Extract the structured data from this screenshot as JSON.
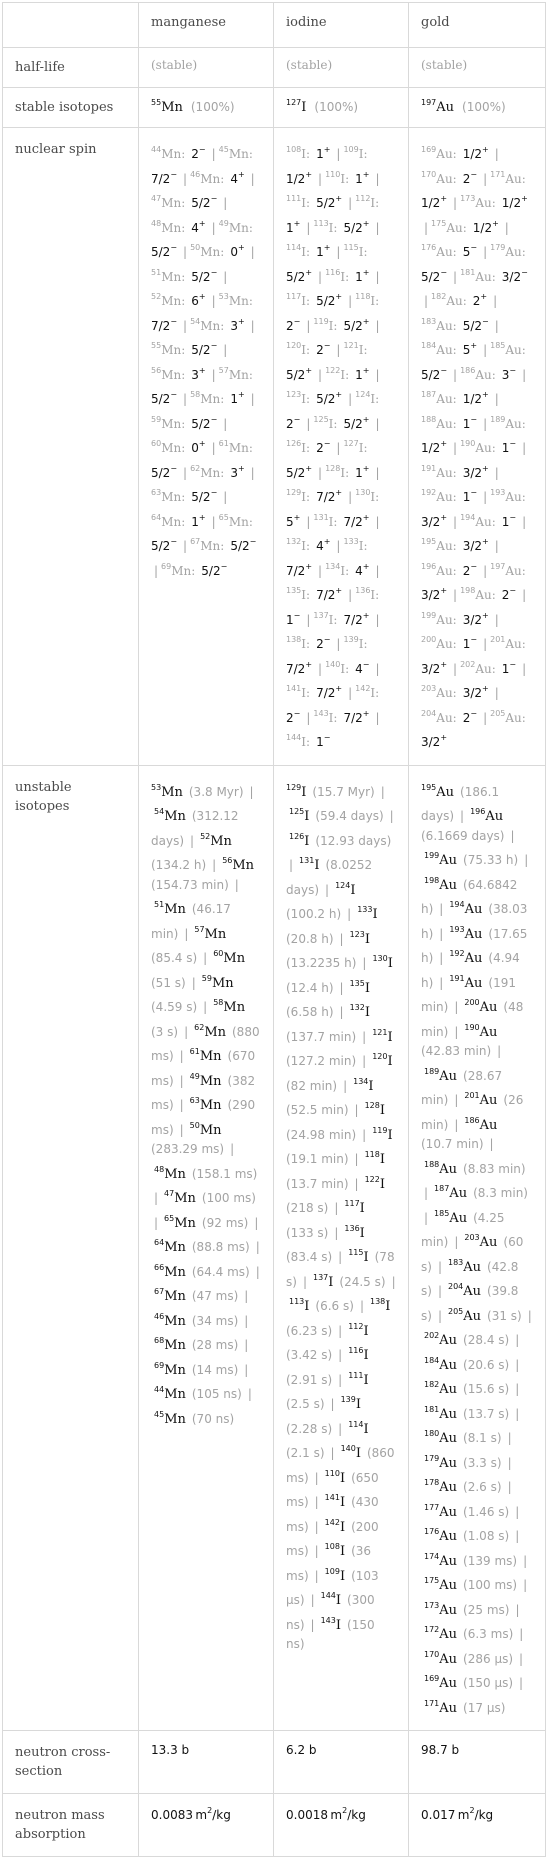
{
  "columns": [
    "manganese",
    "iodine",
    "gold"
  ],
  "rows": {
    "half_life": {
      "label": "half-life",
      "values": [
        "(stable)",
        "(stable)",
        "(stable)"
      ]
    },
    "stable_isotopes": {
      "label": "stable isotopes",
      "values": [
        {
          "mass": "55",
          "symbol": "Mn",
          "abundance": "(100%)"
        },
        {
          "mass": "127",
          "symbol": "I",
          "abundance": "(100%)"
        },
        {
          "mass": "197",
          "symbol": "Au",
          "abundance": "(100%)"
        }
      ]
    },
    "nuclear_spin": {
      "label": "nuclear spin",
      "values": [
        {
          "symbol": "Mn",
          "items": [
            [
              "44",
              "2",
              "−"
            ],
            [
              "45",
              "7/2",
              "−"
            ],
            [
              "46",
              "4",
              "+"
            ],
            [
              "47",
              "5/2",
              "−"
            ],
            [
              "48",
              "4",
              "+"
            ],
            [
              "49",
              "5/2",
              "−"
            ],
            [
              "50",
              "0",
              "+"
            ],
            [
              "51",
              "5/2",
              "−"
            ],
            [
              "52",
              "6",
              "+"
            ],
            [
              "53",
              "7/2",
              "−"
            ],
            [
              "54",
              "3",
              "+"
            ],
            [
              "55",
              "5/2",
              "−"
            ],
            [
              "56",
              "3",
              "+"
            ],
            [
              "57",
              "5/2",
              "−"
            ],
            [
              "58",
              "1",
              "+"
            ],
            [
              "59",
              "5/2",
              "−"
            ],
            [
              "60",
              "0",
              "+"
            ],
            [
              "61",
              "5/2",
              "−"
            ],
            [
              "62",
              "3",
              "+"
            ],
            [
              "63",
              "5/2",
              "−"
            ],
            [
              "64",
              "1",
              "+"
            ],
            [
              "65",
              "5/2",
              "−"
            ],
            [
              "67",
              "5/2",
              "−"
            ],
            [
              "69",
              "5/2",
              "−"
            ]
          ]
        },
        {
          "symbol": "I",
          "items": [
            [
              "108",
              "1",
              "+"
            ],
            [
              "109",
              "1/2",
              "+"
            ],
            [
              "110",
              "1",
              "+"
            ],
            [
              "111",
              "5/2",
              "+"
            ],
            [
              "112",
              "1",
              "+"
            ],
            [
              "113",
              "5/2",
              "+"
            ],
            [
              "114",
              "1",
              "+"
            ],
            [
              "115",
              "5/2",
              "+"
            ],
            [
              "116",
              "1",
              "+"
            ],
            [
              "117",
              "5/2",
              "+"
            ],
            [
              "118",
              "2",
              "−"
            ],
            [
              "119",
              "5/2",
              "+"
            ],
            [
              "120",
              "2",
              "−"
            ],
            [
              "121",
              "5/2",
              "+"
            ],
            [
              "122",
              "1",
              "+"
            ],
            [
              "123",
              "5/2",
              "+"
            ],
            [
              "124",
              "2",
              "−"
            ],
            [
              "125",
              "5/2",
              "+"
            ],
            [
              "126",
              "2",
              "−"
            ],
            [
              "127",
              "5/2",
              "+"
            ],
            [
              "128",
              "1",
              "+"
            ],
            [
              "129",
              "7/2",
              "+"
            ],
            [
              "130",
              "5",
              "+"
            ],
            [
              "131",
              "7/2",
              "+"
            ],
            [
              "132",
              "4",
              "+"
            ],
            [
              "133",
              "7/2",
              "+"
            ],
            [
              "134",
              "4",
              "+"
            ],
            [
              "135",
              "7/2",
              "+"
            ],
            [
              "136",
              "1",
              "−"
            ],
            [
              "137",
              "7/2",
              "+"
            ],
            [
              "138",
              "2",
              "−"
            ],
            [
              "139",
              "7/2",
              "+"
            ],
            [
              "140",
              "4",
              "−"
            ],
            [
              "141",
              "7/2",
              "+"
            ],
            [
              "142",
              "2",
              "−"
            ],
            [
              "143",
              "7/2",
              "+"
            ],
            [
              "144",
              "1",
              "−"
            ]
          ]
        },
        {
          "symbol": "Au",
          "items": [
            [
              "169",
              "1/2",
              "+"
            ],
            [
              "170",
              "2",
              "−"
            ],
            [
              "171",
              "1/2",
              "+"
            ],
            [
              "173",
              "1/2",
              "+"
            ],
            [
              "175",
              "1/2",
              "+"
            ],
            [
              "176",
              "5",
              "−"
            ],
            [
              "179",
              "5/2",
              "−"
            ],
            [
              "181",
              "3/2",
              "−"
            ],
            [
              "182",
              "2",
              "+"
            ],
            [
              "183",
              "5/2",
              "−"
            ],
            [
              "184",
              "5",
              "+"
            ],
            [
              "185",
              "5/2",
              "−"
            ],
            [
              "186",
              "3",
              "−"
            ],
            [
              "187",
              "1/2",
              "+"
            ],
            [
              "188",
              "1",
              "−"
            ],
            [
              "189",
              "1/2",
              "+"
            ],
            [
              "190",
              "1",
              "−"
            ],
            [
              "191",
              "3/2",
              "+"
            ],
            [
              "192",
              "1",
              "−"
            ],
            [
              "193",
              "3/2",
              "+"
            ],
            [
              "194",
              "1",
              "−"
            ],
            [
              "195",
              "3/2",
              "+"
            ],
            [
              "196",
              "2",
              "−"
            ],
            [
              "197",
              "3/2",
              "+"
            ],
            [
              "198",
              "2",
              "−"
            ],
            [
              "199",
              "3/2",
              "+"
            ],
            [
              "200",
              "1",
              "−"
            ],
            [
              "201",
              "3/2",
              "+"
            ],
            [
              "202",
              "1",
              "−"
            ],
            [
              "203",
              "3/2",
              "+"
            ],
            [
              "204",
              "2",
              "−"
            ],
            [
              "205",
              "3/2",
              "+"
            ]
          ]
        }
      ]
    },
    "unstable_isotopes": {
      "label": "unstable isotopes",
      "values": [
        {
          "symbol": "Mn",
          "items": [
            [
              "53",
              "3.8 Myr"
            ],
            [
              "54",
              "312.12 days"
            ],
            [
              "52",
              "134.2 h"
            ],
            [
              "56",
              "154.73 min"
            ],
            [
              "51",
              "46.17 min"
            ],
            [
              "57",
              "85.4 s"
            ],
            [
              "60",
              "51 s"
            ],
            [
              "59",
              "4.59 s"
            ],
            [
              "58",
              "3 s"
            ],
            [
              "62",
              "880 ms"
            ],
            [
              "61",
              "670 ms"
            ],
            [
              "49",
              "382 ms"
            ],
            [
              "63",
              "290 ms"
            ],
            [
              "50",
              "283.29 ms"
            ],
            [
              "48",
              "158.1 ms"
            ],
            [
              "47",
              "100 ms"
            ],
            [
              "65",
              "92 ms"
            ],
            [
              "64",
              "88.8 ms"
            ],
            [
              "66",
              "64.4 ms"
            ],
            [
              "67",
              "47 ms"
            ],
            [
              "46",
              "34 ms"
            ],
            [
              "68",
              "28 ms"
            ],
            [
              "69",
              "14 ms"
            ],
            [
              "44",
              "105 ns"
            ],
            [
              "45",
              "70 ns"
            ]
          ]
        },
        {
          "symbol": "I",
          "items": [
            [
              "129",
              "15.7 Myr"
            ],
            [
              "125",
              "59.4 days"
            ],
            [
              "126",
              "12.93 days"
            ],
            [
              "131",
              "8.0252 days"
            ],
            [
              "124",
              "100.2 h"
            ],
            [
              "133",
              "20.8 h"
            ],
            [
              "123",
              "13.2235 h"
            ],
            [
              "130",
              "12.4 h"
            ],
            [
              "135",
              "6.58 h"
            ],
            [
              "132",
              "137.7 min"
            ],
            [
              "121",
              "127.2 min"
            ],
            [
              "120",
              "82 min"
            ],
            [
              "134",
              "52.5 min"
            ],
            [
              "128",
              "24.98 min"
            ],
            [
              "119",
              "19.1 min"
            ],
            [
              "118",
              "13.7 min"
            ],
            [
              "122",
              "218 s"
            ],
            [
              "117",
              "133 s"
            ],
            [
              "136",
              "83.4 s"
            ],
            [
              "115",
              "78 s"
            ],
            [
              "137",
              "24.5 s"
            ],
            [
              "113",
              "6.6 s"
            ],
            [
              "138",
              "6.23 s"
            ],
            [
              "112",
              "3.42 s"
            ],
            [
              "116",
              "2.91 s"
            ],
            [
              "111",
              "2.5 s"
            ],
            [
              "139",
              "2.28 s"
            ],
            [
              "114",
              "2.1 s"
            ],
            [
              "140",
              "860 ms"
            ],
            [
              "110",
              "650 ms"
            ],
            [
              "141",
              "430 ms"
            ],
            [
              "142",
              "200 ms"
            ],
            [
              "108",
              "36 ms"
            ],
            [
              "109",
              "103 μs"
            ],
            [
              "144",
              "300 ns"
            ],
            [
              "143",
              "150 ns"
            ]
          ]
        },
        {
          "symbol": "Au",
          "items": [
            [
              "195",
              "186.1 days"
            ],
            [
              "196",
              "6.1669 days"
            ],
            [
              "199",
              "75.33 h"
            ],
            [
              "198",
              "64.6842 h"
            ],
            [
              "194",
              "38.03 h"
            ],
            [
              "193",
              "17.65 h"
            ],
            [
              "192",
              "4.94 h"
            ],
            [
              "191",
              "191 min"
            ],
            [
              "200",
              "48 min"
            ],
            [
              "190",
              "42.83 min"
            ],
            [
              "189",
              "28.67 min"
            ],
            [
              "201",
              "26 min"
            ],
            [
              "186",
              "10.7 min"
            ],
            [
              "188",
              "8.83 min"
            ],
            [
              "187",
              "8.3 min"
            ],
            [
              "185",
              "4.25 min"
            ],
            [
              "203",
              "60 s"
            ],
            [
              "183",
              "42.8 s"
            ],
            [
              "204",
              "39.8 s"
            ],
            [
              "205",
              "31 s"
            ],
            [
              "202",
              "28.4 s"
            ],
            [
              "184",
              "20.6 s"
            ],
            [
              "182",
              "15.6 s"
            ],
            [
              "181",
              "13.7 s"
            ],
            [
              "180",
              "8.1 s"
            ],
            [
              "179",
              "3.3 s"
            ],
            [
              "178",
              "2.6 s"
            ],
            [
              "177",
              "1.46 s"
            ],
            [
              "176",
              "1.08 s"
            ],
            [
              "174",
              "139 ms"
            ],
            [
              "175",
              "100 ms"
            ],
            [
              "173",
              "25 ms"
            ],
            [
              "172",
              "6.3 ms"
            ],
            [
              "170",
              "286 μs"
            ],
            [
              "169",
              "150 μs"
            ],
            [
              "171",
              "17 μs"
            ]
          ]
        }
      ]
    },
    "neutron_cross_section": {
      "label": "neutron cross-section",
      "values": [
        "13.3 b",
        "6.2 b",
        "98.7 b"
      ]
    },
    "neutron_mass_absorption": {
      "label": "neutron mass absorption",
      "values": [
        {
          "number": "0.0083",
          "unit": "m",
          "exp": "2",
          "per": "/kg"
        },
        {
          "number": "0.0018",
          "unit": "m",
          "exp": "2",
          "per": "/kg"
        },
        {
          "number": "0.017",
          "unit": "m",
          "exp": "2",
          "per": "/kg"
        }
      ]
    }
  }
}
